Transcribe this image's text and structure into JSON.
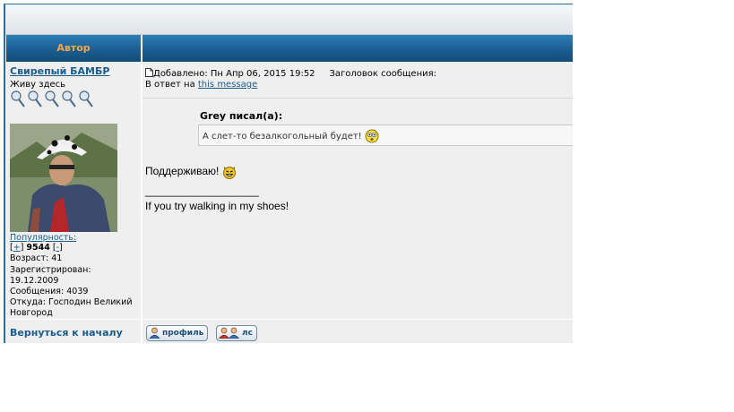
{
  "header": {
    "author_label": "Автор"
  },
  "poster": {
    "name": "Свирепый БАМБР",
    "rank": "Живу здесь",
    "popularity_label": "Популярность:",
    "plus": "+",
    "minus": "-",
    "score": "9544",
    "age": "Возраст: 41",
    "registered_label": "Зарегистрирован:",
    "registered_date": "19.12.2009",
    "messages": "Сообщения: 4039",
    "location_line1": "Откуда: Господин Великий",
    "location_line2": "Новгород"
  },
  "post": {
    "added": "Добавлено: Пн Апр 06, 2015 19:52",
    "subject_label": "Заголовок сообщения:",
    "reply_prefix": "В ответ на",
    "reply_link": "this message",
    "quote_author": "Grey писал(а):",
    "quote_text": "А слет-то безалкогольный будет!",
    "body_text": "Поддерживаю!",
    "signature_line": "___________________",
    "signature": "If you try walking in my shoes!"
  },
  "footer": {
    "back_to_top": "Вернуться к началу",
    "profile_button": "профиль",
    "pm_button": "лс"
  },
  "icons": {
    "post_icon": "document-icon",
    "quote_smiley": "surprised-smiley-icon",
    "body_smiley": "devil-smiley-icon",
    "profile_icon": "user-icon",
    "pm_icon": "users-icon"
  }
}
